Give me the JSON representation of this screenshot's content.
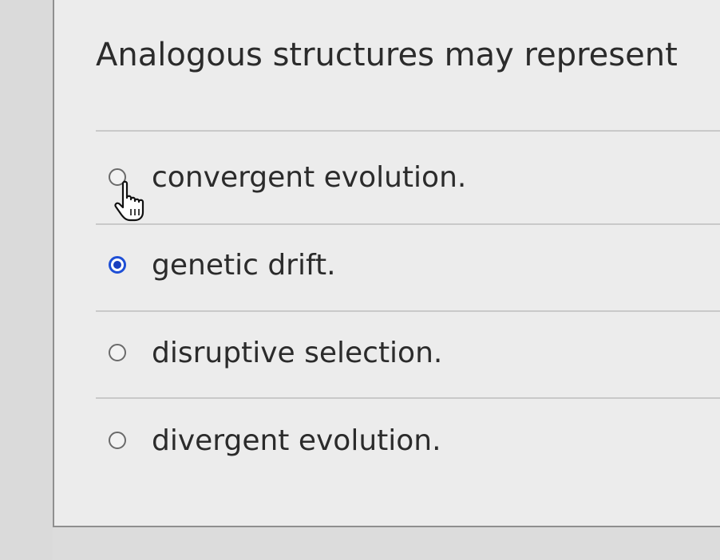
{
  "question": {
    "text": "Analogous structures may represent"
  },
  "options": [
    {
      "label": "convergent evolution.",
      "selected": false
    },
    {
      "label": "genetic drift.",
      "selected": true
    },
    {
      "label": "disruptive selection.",
      "selected": false
    },
    {
      "label": "divergent evolution.",
      "selected": false
    }
  ],
  "cursor": {
    "icon": "hand-pointer-icon"
  },
  "colors": {
    "selected_radio": "#1e4fd6",
    "text": "#2b2b2b"
  }
}
